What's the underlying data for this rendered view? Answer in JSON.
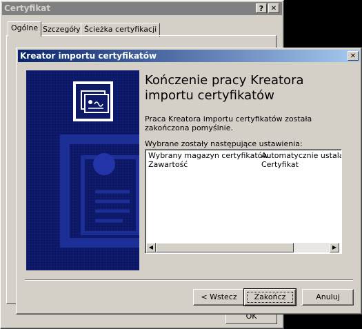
{
  "back_dialog": {
    "title": "Certyfikat",
    "help_button": "?",
    "close_button": "✕",
    "tabs": [
      {
        "label": "Ogólne"
      },
      {
        "label": "Szczegóły"
      },
      {
        "label": "Ścieżka certyfikacji"
      }
    ],
    "ok_label": "OK"
  },
  "wizard": {
    "title": "Kreator importu certyfikatów",
    "close_button": "✕",
    "heading": "Kończenie pracy Kreatora importu certyfikatów",
    "done_message": "Praca Kreatora importu certyfikatów została zakończona pomyślnie.",
    "settings_label": "Wybrane zostały następujące ustawienia:",
    "settings": [
      {
        "name": "Wybrany magazyn certyfikatów",
        "value": "Automatycznie ustalane"
      },
      {
        "name": "Zawartość",
        "value": "Certyfikat"
      }
    ],
    "buttons": {
      "back": "< Wstecz",
      "finish": "Zakończ",
      "cancel": "Anuluj"
    }
  },
  "colors": {
    "titlebar_active": "#0a246a",
    "titlebar_inactive": "#808080",
    "face": "#d4d0c8",
    "side_panel": "#0d1866"
  }
}
